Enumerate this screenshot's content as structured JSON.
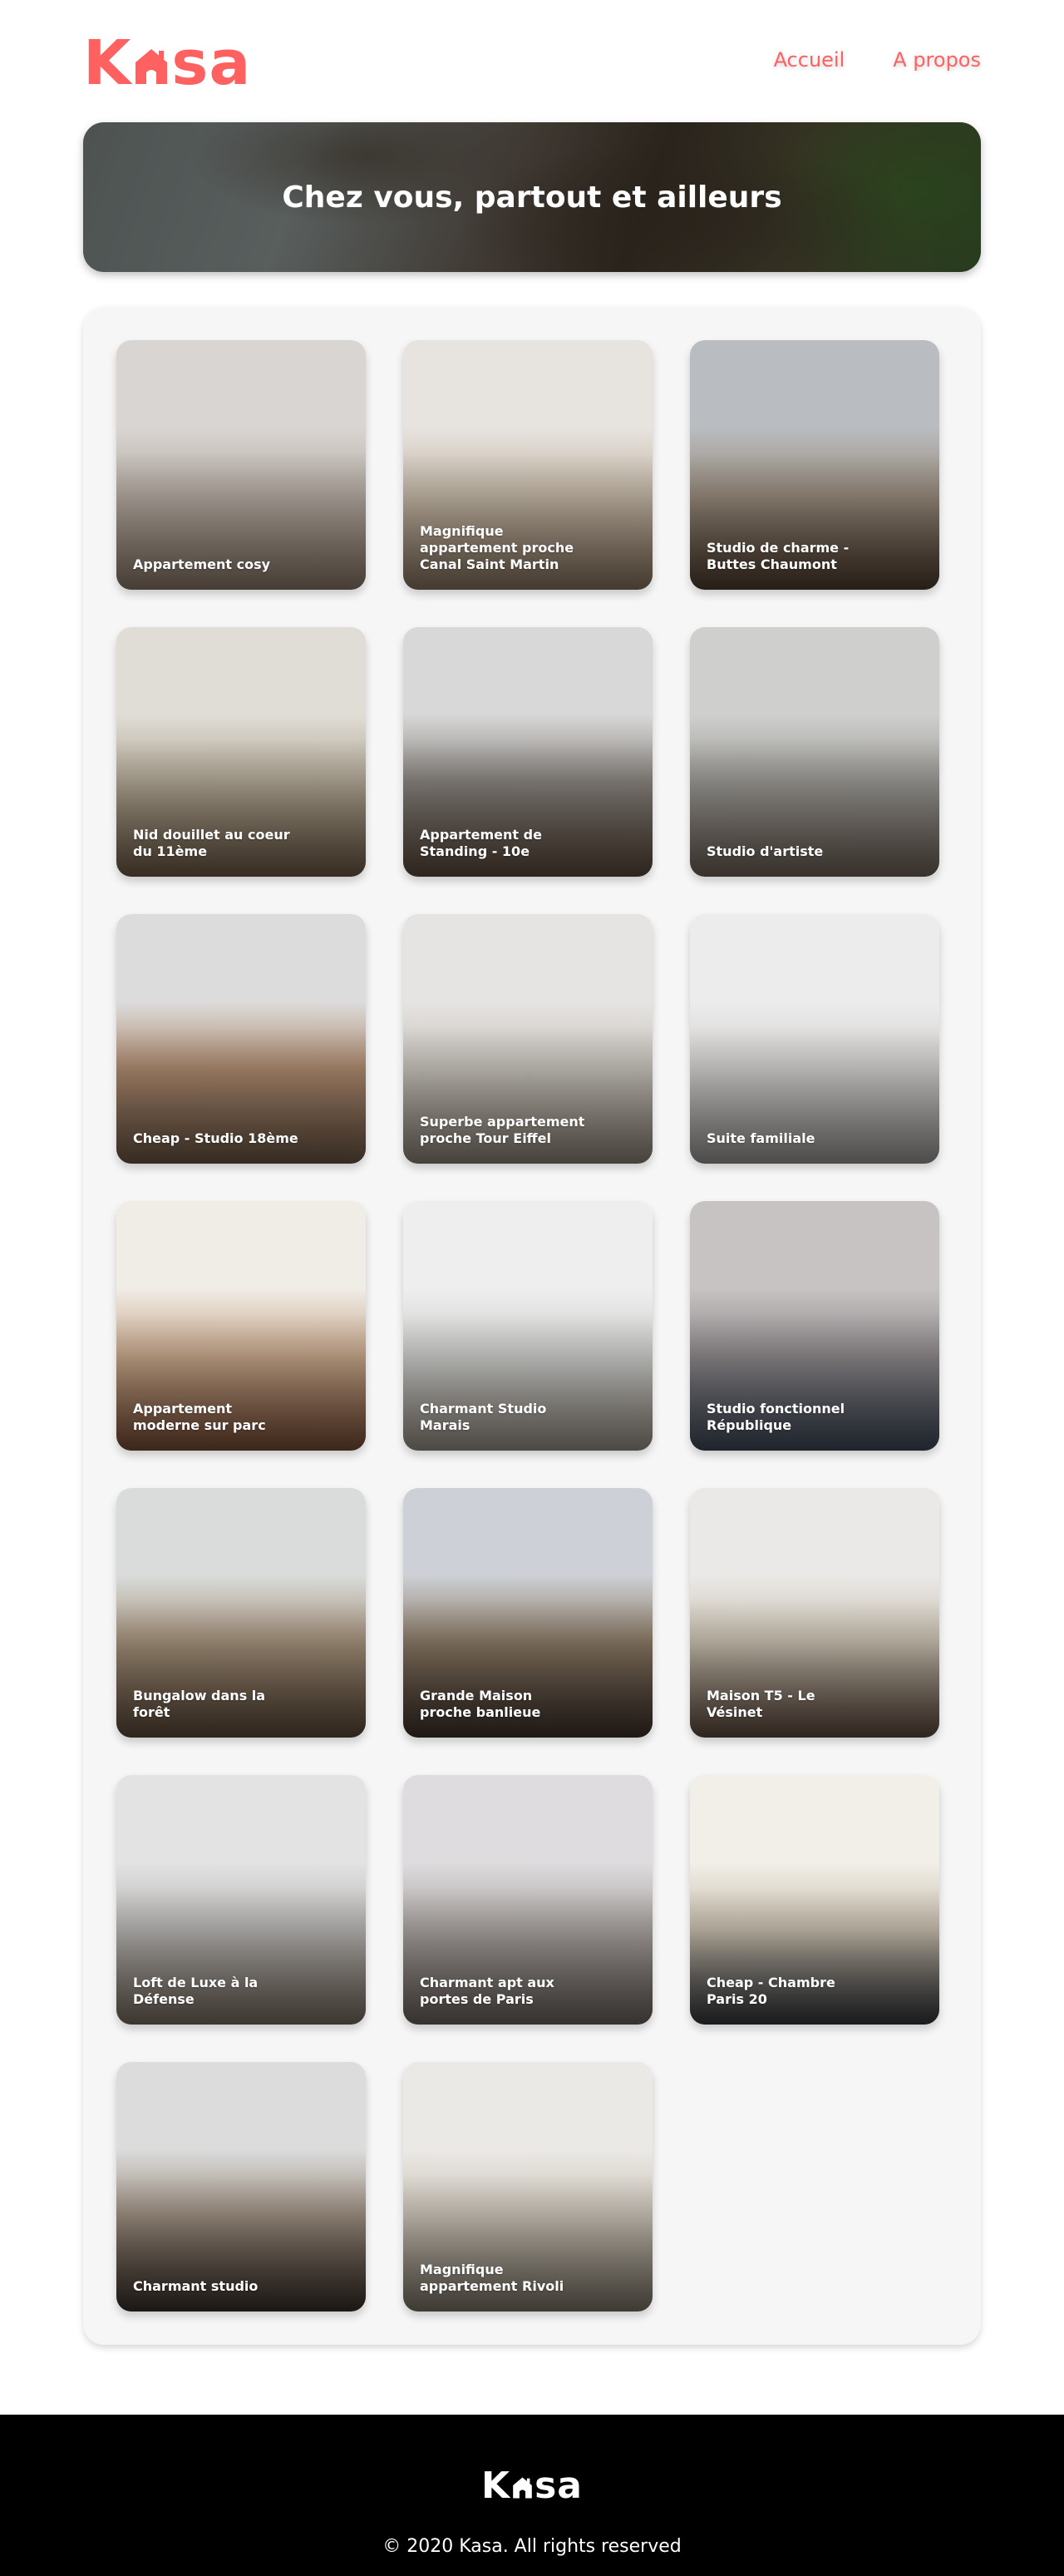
{
  "brand": {
    "logo_text": "Kasa",
    "logo_before": "K",
    "logo_after": "sa",
    "color": "#FF6060"
  },
  "nav": {
    "home_label": "Accueil",
    "about_label": "A propos"
  },
  "banner": {
    "title": "Chez vous, partout et ailleurs"
  },
  "listings": [
    {
      "title": "Appartement cosy",
      "palette": [
        "#d9d5d2",
        "#b6ada4",
        "#8d7b6c"
      ]
    },
    {
      "title": "Magnifique appartement proche Canal Saint Martin",
      "palette": [
        "#e7e3df",
        "#c6b9a8",
        "#8a7560"
      ]
    },
    {
      "title": "Studio de charme - Buttes Chaumont",
      "palette": [
        "#b9bcc0",
        "#9a8d7e",
        "#4e3d2e"
      ]
    },
    {
      "title": "Nid douillet au coeur du 11ème",
      "palette": [
        "#e0ddd6",
        "#b3a997",
        "#6f5a45"
      ]
    },
    {
      "title": "Appartement de Standing - 10e",
      "palette": [
        "#d8d8d8",
        "#8a8580",
        "#5a4a3c"
      ]
    },
    {
      "title": "Studio d'artiste",
      "palette": [
        "#cfd0ce",
        "#9c9a96",
        "#6f6258"
      ]
    },
    {
      "title": "Cheap - Studio 18ème",
      "palette": [
        "#dcdcdc",
        "#b08c70",
        "#6d5846"
      ]
    },
    {
      "title": "Superbe appartement proche Tour Eiffel",
      "palette": [
        "#e6e4e2",
        "#c8c4bd",
        "#8f8478"
      ]
    },
    {
      "title": "Suite familiale",
      "palette": [
        "#ececec",
        "#d4d2d0",
        "#9c9896"
      ]
    },
    {
      "title": "Appartement moderne sur parc",
      "palette": [
        "#f0ece6",
        "#c9a98c",
        "#7a4e36"
      ]
    },
    {
      "title": "Charmant Studio Marais",
      "palette": [
        "#eeeeee",
        "#cfcfcd",
        "#9a9287"
      ]
    },
    {
      "title": "Studio fonctionnel République",
      "palette": [
        "#c7c3c2",
        "#8f8a8c",
        "#3f4958"
      ]
    },
    {
      "title": "Bungalow dans la forêt",
      "palette": [
        "#d9dcdb",
        "#a6927c",
        "#5c4a3a"
      ]
    },
    {
      "title": "Grande Maison proche banlieue",
      "palette": [
        "#cdd0d6",
        "#8b7a66",
        "#3e3129"
      ]
    },
    {
      "title": "Maison T5 - Le Vésinet",
      "palette": [
        "#ebe9e7",
        "#c9c0b0",
        "#5e4b3f"
      ]
    },
    {
      "title": "Loft de Luxe à la Défense",
      "palette": [
        "#e3e3e3",
        "#b9b7b5",
        "#7a6d61"
      ]
    },
    {
      "title": "Charmant apt aux portes de Paris",
      "palette": [
        "#dedcde",
        "#aca6a3",
        "#6b635f"
      ]
    },
    {
      "title": "Cheap - Chambre Paris 20",
      "palette": [
        "#f2efe8",
        "#c9bfae",
        "#33363b"
      ]
    },
    {
      "title": "Charmant studio",
      "palette": [
        "#dcdcdc",
        "#9d8e80",
        "#3a2f29"
      ]
    },
    {
      "title": "Magnifique appartement Rivoli",
      "palette": [
        "#ebe9e6",
        "#cbc3b7",
        "#7d7568"
      ]
    }
  ],
  "footer": {
    "copyright": "© 2020 Kasa. All rights reserved",
    "logo_color": "#ffffff"
  }
}
